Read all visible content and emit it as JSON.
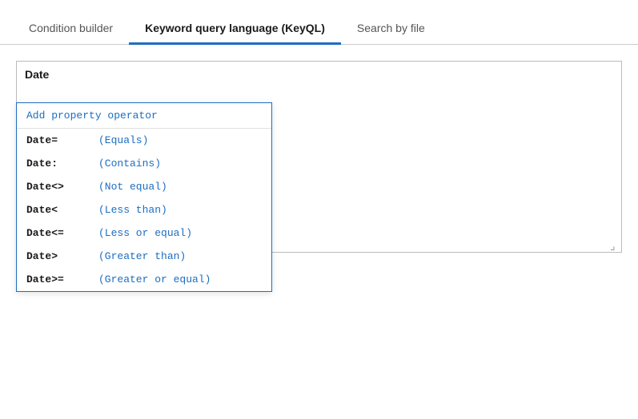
{
  "tabs": [
    {
      "id": "condition-builder",
      "label": "Condition builder",
      "active": false
    },
    {
      "id": "keyql",
      "label": "Keyword query language (KeyQL)",
      "active": true
    },
    {
      "id": "search-by-file",
      "label": "Search by file",
      "active": false
    }
  ],
  "queryArea": {
    "label": "Date"
  },
  "dropdown": {
    "header": "Add property operator",
    "items": [
      {
        "key": "Date=",
        "desc": "(Equals)"
      },
      {
        "key": "Date:",
        "desc": "(Contains)"
      },
      {
        "key": "Date<>",
        "desc": "(Not equal)"
      },
      {
        "key": "Date<",
        "desc": "(Less than)"
      },
      {
        "key": "Date<=",
        "desc": "(Less or equal)"
      },
      {
        "key": "Date>",
        "desc": "(Greater than)"
      },
      {
        "key": "Date>=",
        "desc": "(Greater or equal)"
      }
    ]
  }
}
